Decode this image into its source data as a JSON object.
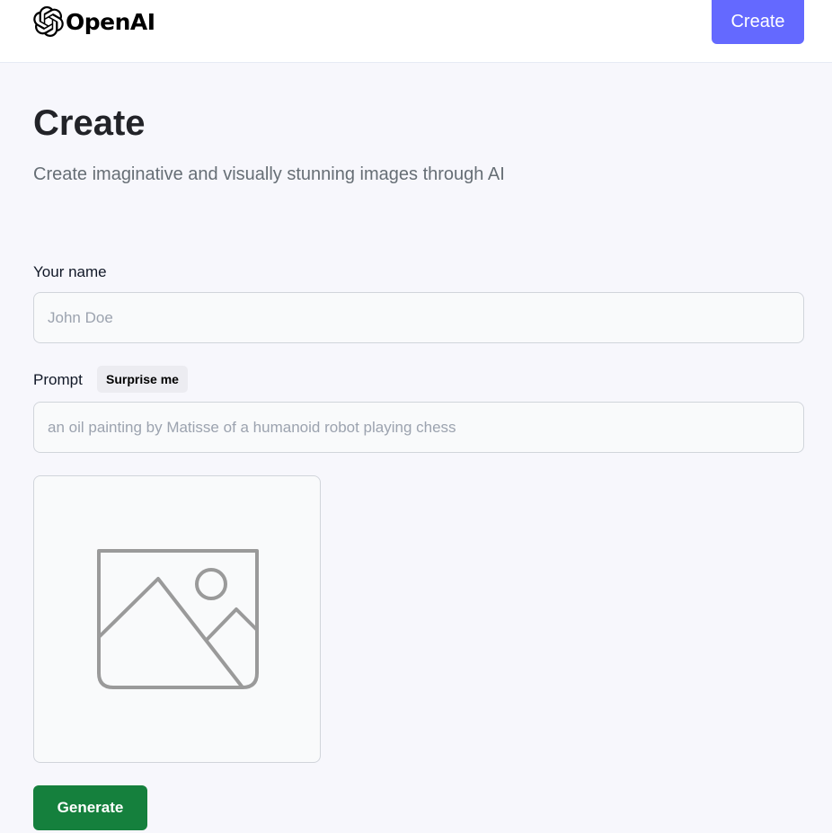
{
  "header": {
    "logo_text": "OpenAI",
    "logo_icon": "openai-logo-icon",
    "create_button_label": "Create"
  },
  "main": {
    "title": "Create",
    "subtitle": "Create imaginative and visually stunning images through AI"
  },
  "form": {
    "name_label": "Your name",
    "name_placeholder": "John Doe",
    "name_value": "",
    "prompt_label": "Prompt",
    "surprise_label": "Surprise me",
    "prompt_placeholder": "an oil painting by Matisse of a humanoid robot playing chess",
    "prompt_value": "",
    "preview_icon": "image-placeholder-icon",
    "generate_label": "Generate"
  },
  "colors": {
    "accent": "#6469ff",
    "generate": "#15803d",
    "background": "#f7f7fc",
    "title": "#222328",
    "subtitle": "#666e75"
  }
}
